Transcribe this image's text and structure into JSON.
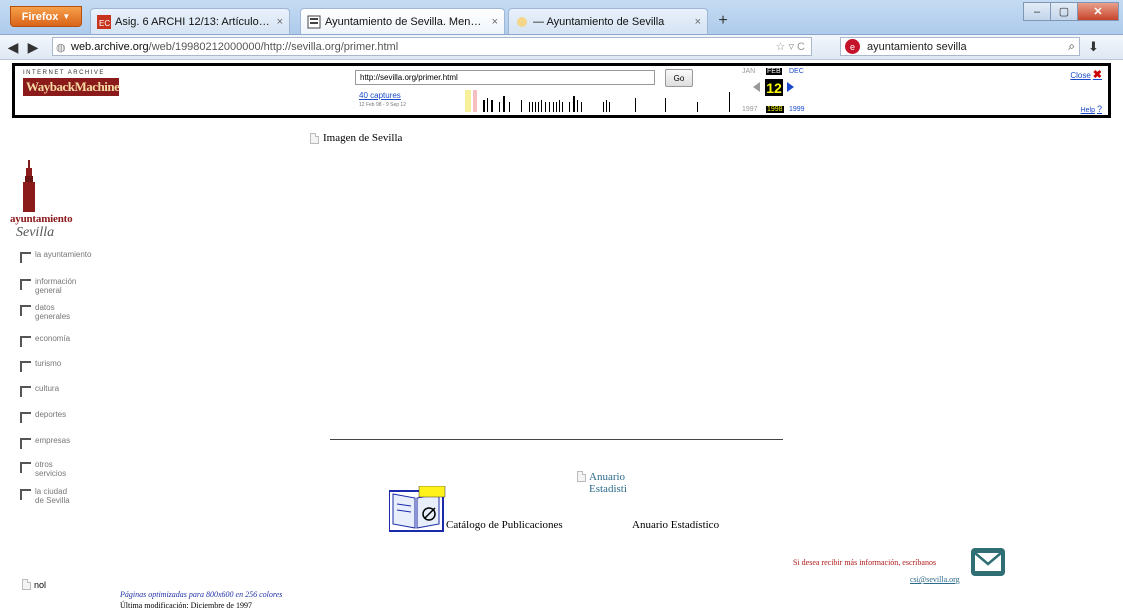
{
  "browser": {
    "app_button": "Firefox",
    "tabs": [
      {
        "label": "Asig. 6 ARCHI 12/13: Artículo 6.8. El a...",
        "active": false
      },
      {
        "label": "Ayuntamiento de Sevilla. Menú Princi...",
        "active": true
      },
      {
        "label": "— Ayuntamiento de Sevilla",
        "active": false
      }
    ],
    "tab_close_symbol": "×",
    "new_tab_symbol": "+",
    "window_buttons": [
      "–",
      "▢",
      "✕"
    ],
    "url_host": "web.archive.org",
    "url_path": "/web/19980212000000/http://sevilla.org/primer.html",
    "search_text": "ayuntamiento sevilla"
  },
  "wayback": {
    "logo_top": "INTERNET ARCHIVE",
    "logo_main": "WaybackMachine",
    "url_value": "http://sevilla.org/primer.html",
    "go_label": "Go",
    "captures_label": "40 captures",
    "range_label": "12 Feb 98 - 9 Sep 12",
    "month_prev": "JAN",
    "month_cur": "FEB",
    "month_next": "DEC",
    "day": "12",
    "year_prev": "1997",
    "year_cur": "1998",
    "year_next": "1999",
    "close_label": "Close",
    "help_label": "Help"
  },
  "page": {
    "image_alt": "Imagen de Sevilla",
    "logo_text": "ayuntamiento",
    "logo_script": "Sevilla",
    "menu": [
      "la ayuntamiento",
      "información\ngeneral",
      "datos\ngenerales",
      "economía",
      "turismo",
      "cultura",
      "deportes",
      "empresas",
      "otros\nservicios",
      "la ciudad\nde Sevilla"
    ],
    "anuario_small": "Anuario\nEstadisti",
    "catalogo_label": "Catálogo de Publicaciones",
    "anuario_label": "Anuario Estadístico",
    "nol": "nol",
    "optim_text": "Páginas optimizadas para 800x600 en 256 colores",
    "ultima_text": "Última modificación: Diciembre de 1997",
    "info_text": "Si desea recibir más información, escríbanos",
    "info_email": "csi@sevilla.org"
  }
}
